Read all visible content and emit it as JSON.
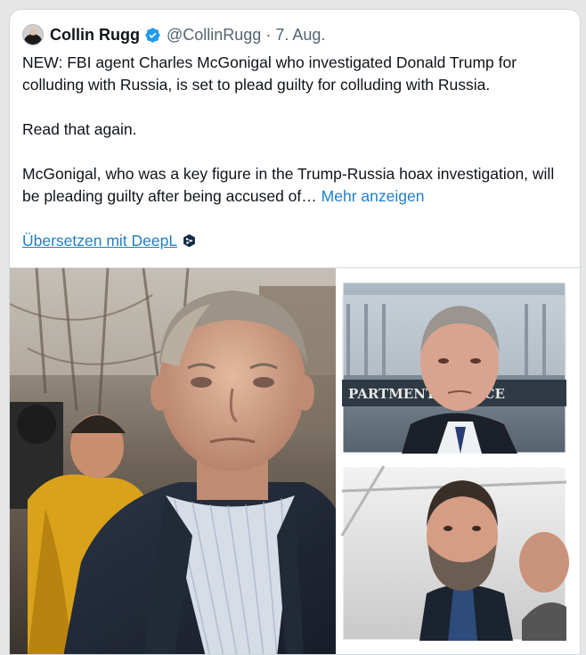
{
  "tweet": {
    "author_name": "Collin Rugg",
    "author_handle": "@CollinRugg",
    "separator": "·",
    "date": "7. Aug.",
    "paragraphs": [
      "NEW: FBI agent Charles McGonigal who investigated Donald Trump for colluding with Russia, is set to plead guilty for colluding with Russia.",
      "Read that again.",
      "McGonigal, who was a key figure in the Trump-Russia hoax investigation, will be pleading guilty after being accused of…"
    ],
    "show_more_label": "Mehr anzeigen",
    "translate_label": "Übersetzen mit DeepL",
    "verified_color": "#1d9bf0",
    "link_color": "#1d7fc9"
  },
  "media": {
    "inset_top_sign_text": "PARTMENT   JUSTICE"
  },
  "icons": {
    "verified": "verified-badge-icon",
    "deepl": "deepl-logo-icon"
  }
}
